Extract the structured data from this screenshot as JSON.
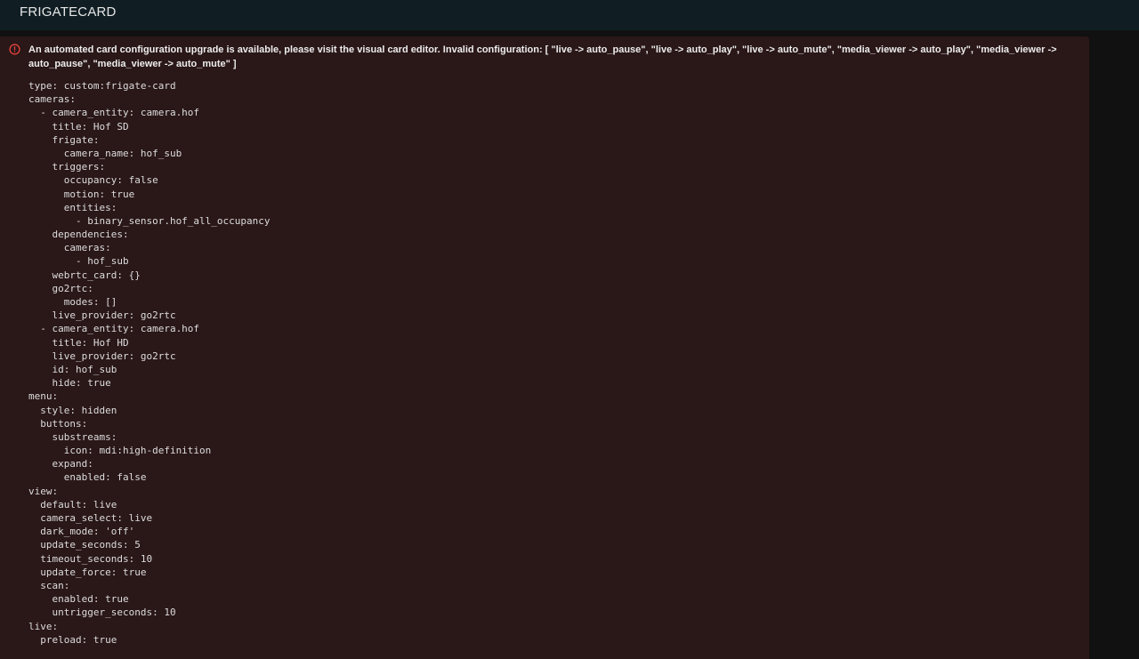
{
  "header": {
    "title": "FRIGATECARD"
  },
  "card": {
    "warning_icon": "alert-circle-outline-icon",
    "warning_text": "An automated card configuration upgrade is available, please visit the visual card editor. Invalid configuration: [ \"live -> auto_pause\", \"live -> auto_play\", \"live -> auto_mute\", \"media_viewer -> auto_play\", \"media_viewer -> auto_pause\", \"media_viewer -> auto_mute\" ]",
    "colors": {
      "card_background": "#2a1718",
      "warning_icon": "#e5443d",
      "topbar_background": "#101e24"
    },
    "yaml_lines": [
      "type: custom:frigate-card",
      "cameras:",
      "  - camera_entity: camera.hof",
      "    title: Hof SD",
      "    frigate:",
      "      camera_name: hof_sub",
      "    triggers:",
      "      occupancy: false",
      "      motion: true",
      "      entities:",
      "        - binary_sensor.hof_all_occupancy",
      "    dependencies:",
      "      cameras:",
      "        - hof_sub",
      "    webrtc_card: {}",
      "    go2rtc:",
      "      modes: []",
      "    live_provider: go2rtc",
      "  - camera_entity: camera.hof",
      "    title: Hof HD",
      "    live_provider: go2rtc",
      "    id: hof_sub",
      "    hide: true",
      "menu:",
      "  style: hidden",
      "  buttons:",
      "    substreams:",
      "      icon: mdi:high-definition",
      "    expand:",
      "      enabled: false",
      "view:",
      "  default: live",
      "  camera_select: live",
      "  dark_mode: 'off'",
      "  update_seconds: 5",
      "  timeout_seconds: 10",
      "  update_force: true",
      "  scan:",
      "    enabled: true",
      "    untrigger_seconds: 10",
      "live:",
      "  preload: true"
    ]
  }
}
